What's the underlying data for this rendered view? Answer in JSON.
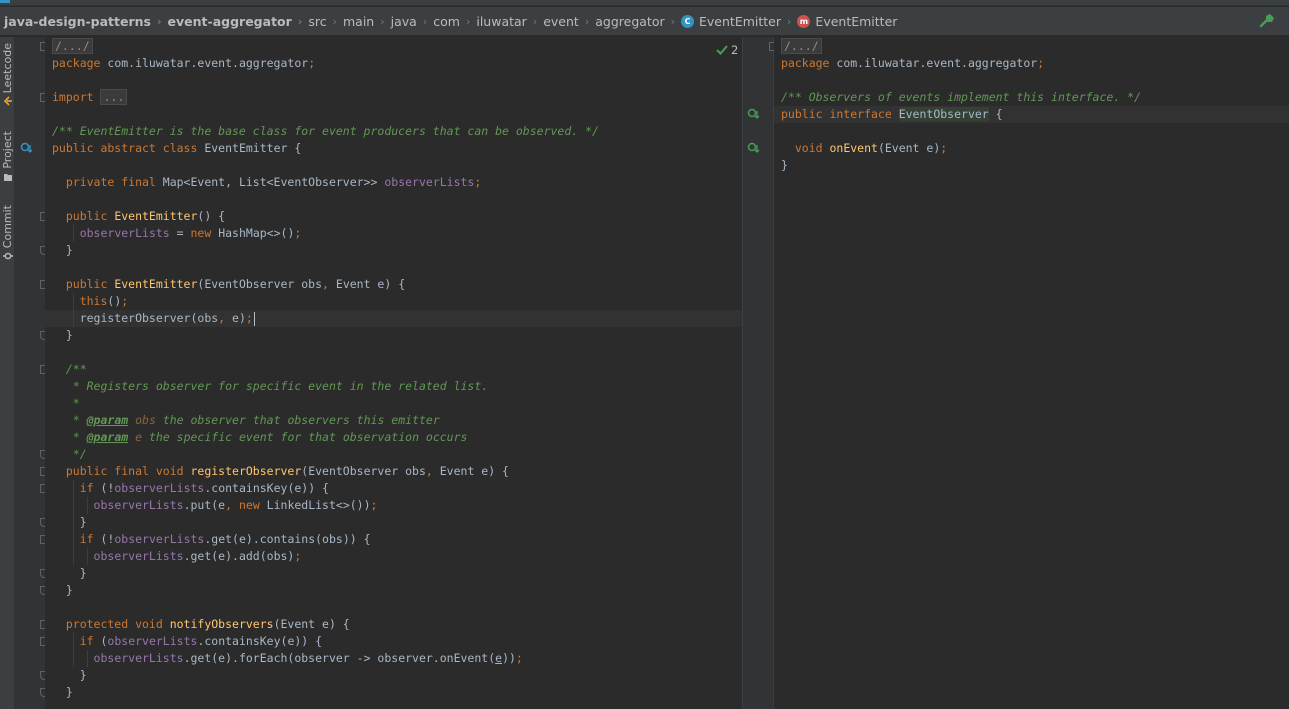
{
  "breadcrumbs": [
    {
      "label": "java-design-patterns",
      "bold": true,
      "icon": ""
    },
    {
      "label": "event-aggregator",
      "bold": true,
      "icon": ""
    },
    {
      "label": "src",
      "bold": false,
      "icon": ""
    },
    {
      "label": "main",
      "bold": false,
      "icon": ""
    },
    {
      "label": "java",
      "bold": false,
      "icon": ""
    },
    {
      "label": "com",
      "bold": false,
      "icon": ""
    },
    {
      "label": "iluwatar",
      "bold": false,
      "icon": ""
    },
    {
      "label": "event",
      "bold": false,
      "icon": ""
    },
    {
      "label": "aggregator",
      "bold": false,
      "icon": ""
    },
    {
      "label": "EventEmitter",
      "bold": false,
      "icon": "class-icon",
      "icon_letter": "C"
    },
    {
      "label": "EventEmitter",
      "bold": false,
      "icon": "method-icon",
      "icon_letter": "m"
    }
  ],
  "sidebar": {
    "tabs": [
      {
        "label": "Leetcode",
        "icon": "leetcode-icon"
      },
      {
        "label": "Project",
        "icon": "folder-icon"
      },
      {
        "label": "Commit",
        "icon": "commit-icon"
      }
    ]
  },
  "inspection": {
    "count": "2",
    "icon": "check-icon"
  },
  "colors": {
    "keyword": "#cc7832",
    "field": "#9876aa",
    "function": "#ffc66d",
    "doc_comment": "#629755",
    "line_comment": "#808080",
    "text": "#a9b7c6",
    "background": "#2b2b2b"
  },
  "left_editor": {
    "file": "EventEmitter.java",
    "lines": [
      [
        {
          "t": "/.../",
          "c": "fold-box"
        }
      ],
      [
        {
          "t": "package ",
          "c": "kw"
        },
        {
          "t": "com.iluwatar.event.aggregator"
        },
        {
          "t": ";",
          "c": "kw"
        }
      ],
      [],
      [
        {
          "t": "import ",
          "c": "kw"
        },
        {
          "t": "...",
          "c": "fold-box"
        }
      ],
      [],
      [
        {
          "t": "/** EventEmitter is the base class for event producers that can be observed. */",
          "c": "cm"
        }
      ],
      [
        {
          "t": "public abstract class ",
          "c": "kw"
        },
        {
          "t": "EventEmitter {"
        }
      ],
      [],
      [
        {
          "t": "  private final ",
          "c": "kw"
        },
        {
          "t": "Map<Event, List<EventObserver>> "
        },
        {
          "t": "observerLists",
          "c": "fld"
        },
        {
          "t": ";",
          "c": "kw"
        }
      ],
      [],
      [
        {
          "t": "  public ",
          "c": "kw"
        },
        {
          "t": "EventEmitter",
          "c": "fn"
        },
        {
          "t": "() {"
        }
      ],
      [
        {
          "t": "    "
        },
        {
          "t": "observerLists",
          "c": "fld"
        },
        {
          "t": " = "
        },
        {
          "t": "new ",
          "c": "kw"
        },
        {
          "t": "HashMap<>()"
        },
        {
          "t": ";",
          "c": "kw"
        }
      ],
      [
        {
          "t": "  }"
        }
      ],
      [],
      [
        {
          "t": "  public ",
          "c": "kw"
        },
        {
          "t": "EventEmitter",
          "c": "fn"
        },
        {
          "t": "(EventObserver obs"
        },
        {
          "t": ", ",
          "c": "kw"
        },
        {
          "t": "Event e) {"
        }
      ],
      [
        {
          "t": "    "
        },
        {
          "t": "this",
          "c": "kw"
        },
        {
          "t": "()"
        },
        {
          "t": ";",
          "c": "kw"
        }
      ],
      [
        {
          "t": "    registerObserver(obs"
        },
        {
          "t": ", ",
          "c": "kw"
        },
        {
          "t": "e)"
        },
        {
          "t": ";",
          "c": "kw"
        },
        {
          "t": "",
          "c": "caret"
        }
      ],
      [
        {
          "t": "  }"
        }
      ],
      [],
      [
        {
          "t": "  /**",
          "c": "cm"
        }
      ],
      [
        {
          "t": "   * Registers observer for specific event in the related list.",
          "c": "cm"
        }
      ],
      [
        {
          "t": "   *",
          "c": "cm"
        }
      ],
      [
        {
          "t": "   * ",
          "c": "cm"
        },
        {
          "t": "@param",
          "c": "tag"
        },
        {
          "t": " ",
          "c": "cm"
        },
        {
          "t": "obs",
          "c": "prm"
        },
        {
          "t": " the observer that observers this emitter",
          "c": "cm"
        }
      ],
      [
        {
          "t": "   * ",
          "c": "cm"
        },
        {
          "t": "@param",
          "c": "tag"
        },
        {
          "t": " ",
          "c": "cm"
        },
        {
          "t": "e",
          "c": "prm"
        },
        {
          "t": " the specific event for that observation occurs",
          "c": "cm"
        }
      ],
      [
        {
          "t": "   */",
          "c": "cm"
        }
      ],
      [
        {
          "t": "  public final void ",
          "c": "kw"
        },
        {
          "t": "registerObserver",
          "c": "fn"
        },
        {
          "t": "(EventObserver obs"
        },
        {
          "t": ", ",
          "c": "kw"
        },
        {
          "t": "Event e) {"
        }
      ],
      [
        {
          "t": "    "
        },
        {
          "t": "if ",
          "c": "kw"
        },
        {
          "t": "(!"
        },
        {
          "t": "observerLists",
          "c": "fld"
        },
        {
          "t": ".containsKey(e)) {"
        }
      ],
      [
        {
          "t": "      "
        },
        {
          "t": "observerLists",
          "c": "fld"
        },
        {
          "t": ".put(e"
        },
        {
          "t": ", ",
          "c": "kw"
        },
        {
          "t": "new ",
          "c": "kw"
        },
        {
          "t": "LinkedList<>())"
        },
        {
          "t": ";",
          "c": "kw"
        }
      ],
      [
        {
          "t": "    }"
        }
      ],
      [
        {
          "t": "    "
        },
        {
          "t": "if ",
          "c": "kw"
        },
        {
          "t": "(!"
        },
        {
          "t": "observerLists",
          "c": "fld"
        },
        {
          "t": ".get(e).contains(obs)) {"
        }
      ],
      [
        {
          "t": "      "
        },
        {
          "t": "observerLists",
          "c": "fld"
        },
        {
          "t": ".get(e).add(obs)"
        },
        {
          "t": ";",
          "c": "kw"
        }
      ],
      [
        {
          "t": "    }"
        }
      ],
      [
        {
          "t": "  }"
        }
      ],
      [],
      [
        {
          "t": "  protected void ",
          "c": "kw"
        },
        {
          "t": "notifyObservers",
          "c": "fn"
        },
        {
          "t": "(Event e) {"
        }
      ],
      [
        {
          "t": "    "
        },
        {
          "t": "if ",
          "c": "kw"
        },
        {
          "t": "("
        },
        {
          "t": "observerLists",
          "c": "fld"
        },
        {
          "t": ".containsKey(e)) {"
        }
      ],
      [
        {
          "t": "      "
        },
        {
          "t": "observerLists",
          "c": "fld"
        },
        {
          "t": ".get(e).forEach(observer -> observer.onEvent("
        },
        {
          "t": "e",
          "c": "ul"
        },
        {
          "t": "))"
        },
        {
          "t": ";",
          "c": "kw"
        }
      ],
      [
        {
          "t": "    }"
        }
      ],
      [
        {
          "t": "  }"
        }
      ]
    ]
  },
  "right_editor": {
    "file": "EventObserver.java",
    "lines": [
      [
        {
          "t": "/.../",
          "c": "fold-box"
        }
      ],
      [
        {
          "t": "package ",
          "c": "kw"
        },
        {
          "t": "com.iluwatar.event.aggregator"
        },
        {
          "t": ";",
          "c": "kw"
        }
      ],
      [],
      [
        {
          "t": "/** Observers of events implement this interface. */",
          "c": "cm"
        }
      ],
      [
        {
          "t": "public interface ",
          "c": "kw"
        },
        {
          "t": "EventObserver",
          "c": "hl"
        },
        {
          "t": " {"
        }
      ],
      [],
      [
        {
          "t": "  void ",
          "c": "kw"
        },
        {
          "t": "onEvent",
          "c": "fn"
        },
        {
          "t": "(Event e)"
        },
        {
          "t": ";",
          "c": "kw"
        }
      ],
      [
        {
          "t": "}"
        }
      ]
    ]
  }
}
